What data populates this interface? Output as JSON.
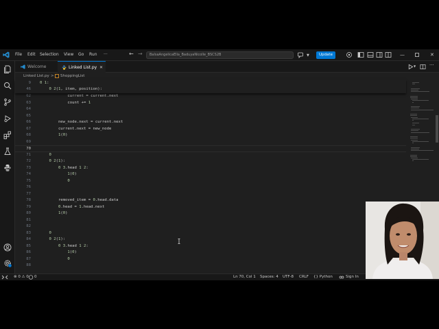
{
  "titlebar": {
    "menu": [
      "File",
      "Edit",
      "Selection",
      "View",
      "Go",
      "Run",
      "···"
    ],
    "search_text": "BalsaAngelicaElla_BaduyaNicolle_BSCS2B",
    "update_label": "Update"
  },
  "tabs": [
    {
      "label": "Welcome",
      "active": false
    },
    {
      "label": "Linked List.py",
      "active": true
    }
  ],
  "breadcrumb": {
    "file": "Linked List.py",
    "separator": ">",
    "symbol": "ShoppingList"
  },
  "sticky_lines": [
    {
      "num": "9",
      "code": "class ShoppingList:"
    },
    {
      "num": "46",
      "code": "    def add_at_position(self, item, position):"
    }
  ],
  "code_lines": [
    {
      "num": "62",
      "code": "            current = current.next"
    },
    {
      "num": "63",
      "code": "            count += 1"
    },
    {
      "num": "64",
      "code": ""
    },
    {
      "num": "65",
      "code": ""
    },
    {
      "num": "66",
      "code": "        new_node.next = current.next"
    },
    {
      "num": "67",
      "code": "        current.next = new_node"
    },
    {
      "num": "68",
      "code": "        print(f\"Success: '{item}' inserted at position {position}.\")"
    },
    {
      "num": "69",
      "code": ""
    },
    {
      "num": "70",
      "code": ""
    },
    {
      "num": "71",
      "code": "    # [4] Remove Item at Start"
    },
    {
      "num": "72",
      "code": "    def remove_at_start(self):"
    },
    {
      "num": "73",
      "code": "        if self.head is None:"
    },
    {
      "num": "74",
      "code": "            print(\"Error: The shopping list is currently empty.\")"
    },
    {
      "num": "75",
      "code": "            return"
    },
    {
      "num": "76",
      "code": ""
    },
    {
      "num": "77",
      "code": ""
    },
    {
      "num": "78",
      "code": "        removed_item = self.head.data"
    },
    {
      "num": "79",
      "code": "        self.head = self.head.next"
    },
    {
      "num": "80",
      "code": "        print(f\"Success: Removed '{removed_item}' from the start of your list.\")"
    },
    {
      "num": "81",
      "code": ""
    },
    {
      "num": "82",
      "code": ""
    },
    {
      "num": "83",
      "code": "    # [5] Remove Item at End"
    },
    {
      "num": "84",
      "code": "    def remove_at_end(self):"
    },
    {
      "num": "85",
      "code": "        if self.head is None:"
    },
    {
      "num": "86",
      "code": "            print(\"Error: The shopping list is currently empty.\")"
    },
    {
      "num": "87",
      "code": "            return"
    },
    {
      "num": "88",
      "code": ""
    }
  ],
  "current_line": "70",
  "statusbar": {
    "problems": "⊗ 0 ⚠ 0",
    "ports": "0",
    "position": "Ln 70, Col 1",
    "spaces": "Spaces: 4",
    "encoding": "UTF-8",
    "eol": "CRLF",
    "language": "{} Python",
    "account": "Sign In"
  },
  "colors": {
    "accent": "#0078d4",
    "background": "#1f1f1f",
    "keyword": "#569cd6",
    "string": "#ce9178",
    "comment": "#6a9955",
    "function": "#dcdcaa"
  }
}
